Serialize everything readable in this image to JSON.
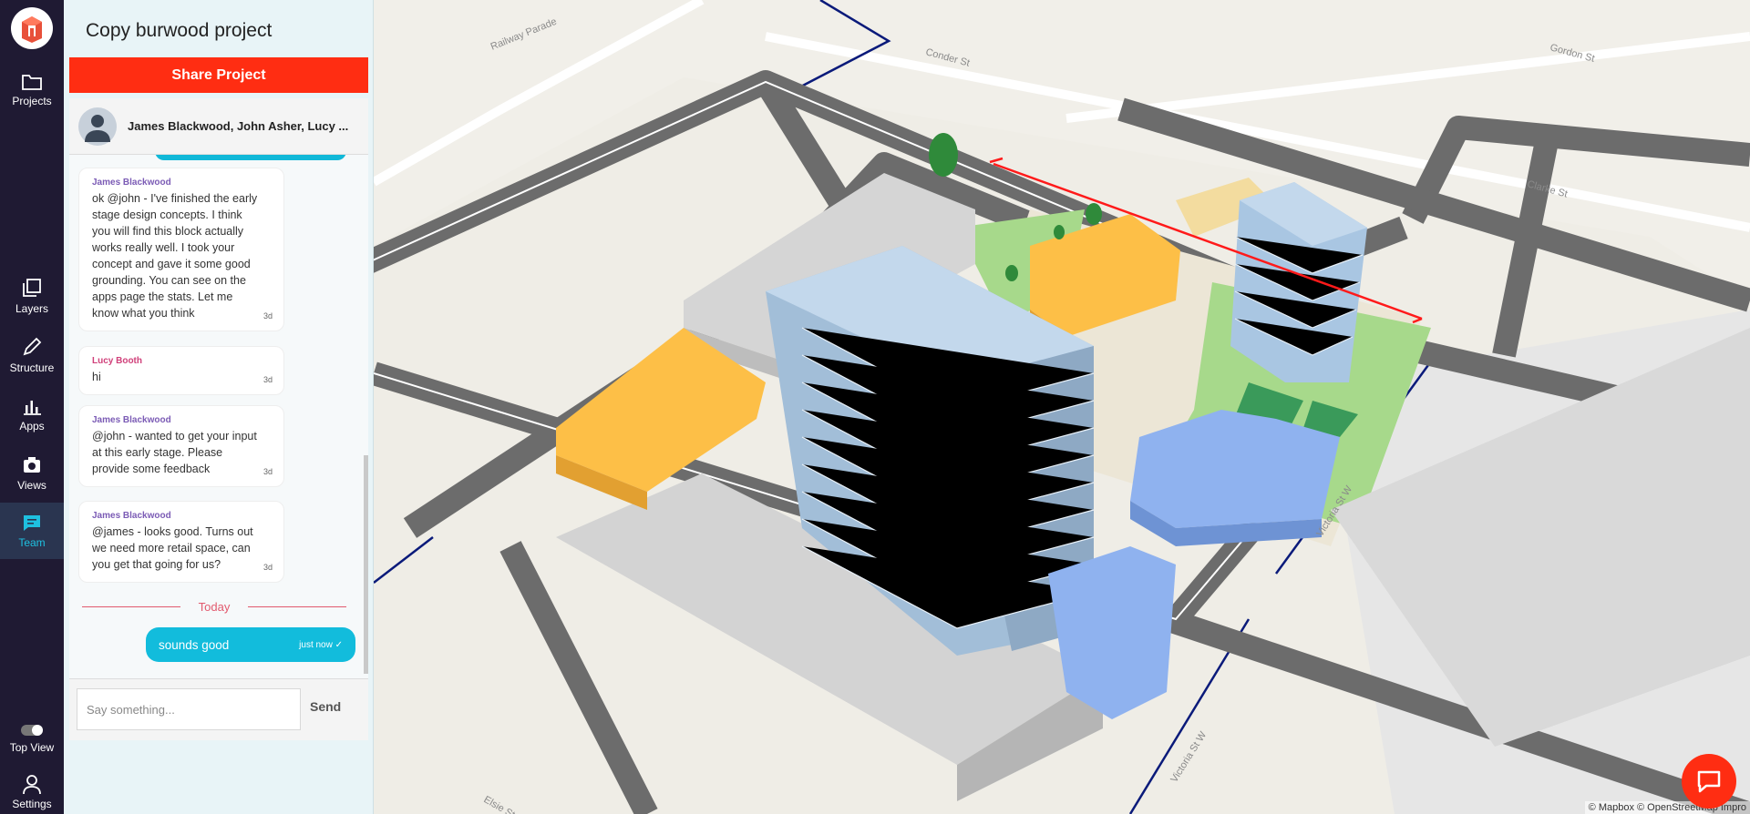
{
  "project": {
    "title": "Copy burwood project",
    "share_label": "Share Project"
  },
  "nav": {
    "items": [
      {
        "label": "Projects",
        "icon": "folder-icon"
      },
      {
        "label": "Layers",
        "icon": "layers-icon"
      },
      {
        "label": "Structure",
        "icon": "pencil-icon"
      },
      {
        "label": "Apps",
        "icon": "bar-chart-icon"
      },
      {
        "label": "Views",
        "icon": "camera-icon"
      },
      {
        "label": "Team",
        "icon": "chat-icon"
      },
      {
        "label": "Top View",
        "icon": "toggle-icon"
      },
      {
        "label": "Settings",
        "icon": "user-icon"
      }
    ],
    "active": "Team"
  },
  "chat": {
    "members": "James Blackwood, John Asher, Lucy ...",
    "messages": [
      {
        "author": "James Blackwood",
        "body": "ok @john - I've finished the early stage design concepts. I think you will find this block actually works really well. I took your concept and gave it some good grounding. You can see on the apps page the stats. Let me know what you think",
        "time": "3d"
      },
      {
        "author": "Lucy Booth",
        "body": "hi",
        "time": "3d"
      },
      {
        "author": "James Blackwood",
        "body": "@john - wanted to get your input at this early stage. Please provide some feedback",
        "time": "3d"
      },
      {
        "author": "James Blackwood",
        "body": "@james - looks good. Turns out we need more retail space, can you get that going for us?",
        "time": "3d"
      }
    ],
    "divider": "Today",
    "my_message": {
      "body": "sounds good",
      "time": "just now ✓"
    },
    "composer": {
      "placeholder": "Say something...",
      "send_label": "Send"
    }
  },
  "map": {
    "street_labels": [
      "Railway Parade",
      "Conder St",
      "Gordon St",
      "Clarke St",
      "Victoria St W",
      "Victoria St W",
      "Elsie St"
    ],
    "attribution": "© Mapbox © OpenStreetMap Impro",
    "colors": {
      "building_blue": "#b9d3ea",
      "building_yellow": "#fdbf47",
      "building_mid_blue": "#8fb2ef",
      "park_green": "#a7d98b",
      "road": "#6e6e6e",
      "brand_red": "#ff2d12"
    }
  }
}
